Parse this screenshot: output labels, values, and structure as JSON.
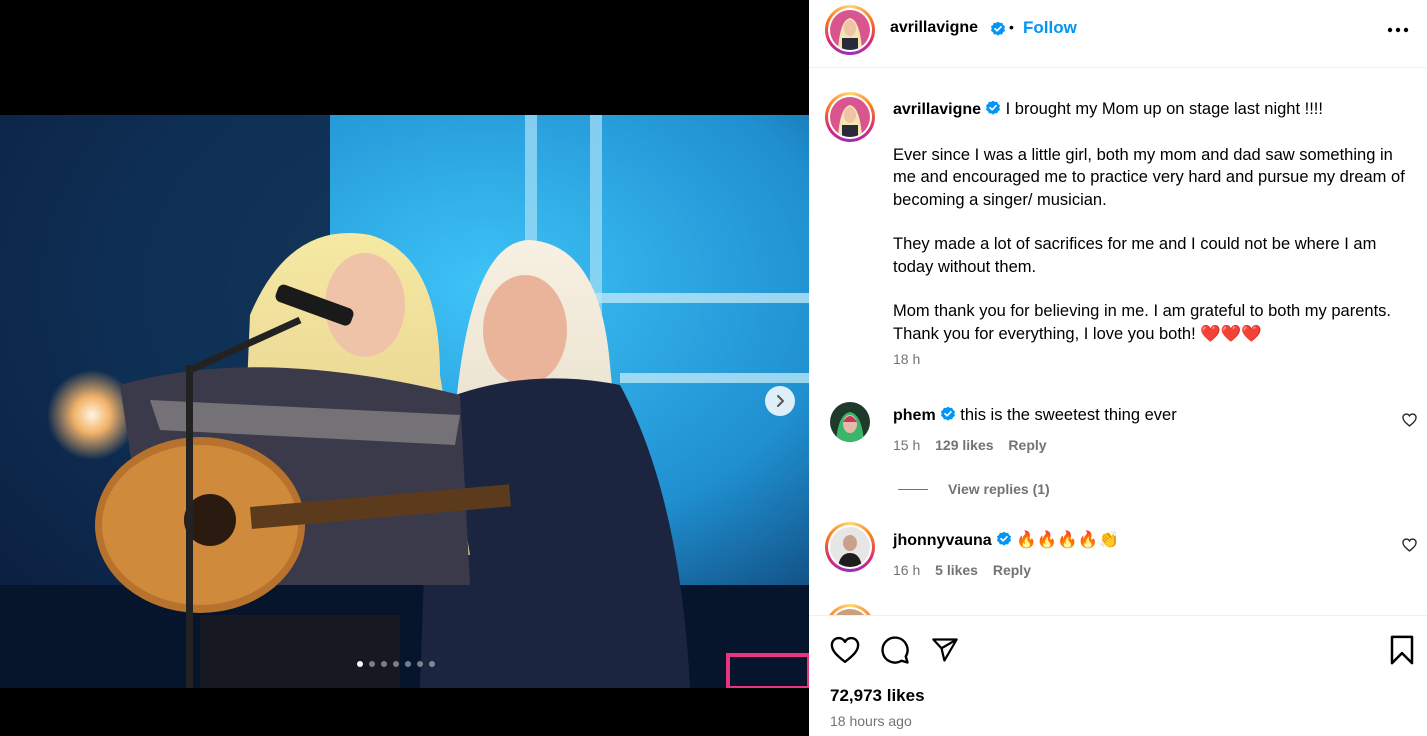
{
  "post": {
    "username": "avrillavigne",
    "separator": "•",
    "follow_label": "Follow",
    "more_icon": "more-horizontal-icon"
  },
  "caption": {
    "username": "avrillavigne",
    "line1": "I brought my Mom up on stage last night !!!!",
    "para1": "Ever since I was a little girl, both my mom and dad saw something in me and encouraged me to practice very hard and pursue my dream of becoming a singer/ musician.",
    "para2": "They made a lot of sacrifices for me and I could not be where I am today without them.",
    "para3": "Mom thank you for believing in me. I am grateful to both my parents. Thank you for everything, I love you both! ❤️❤️❤️",
    "time": "18 h"
  },
  "comments": [
    {
      "username": "phem",
      "text": "this is the sweetest thing ever",
      "time": "15 h",
      "likes": "129 likes",
      "reply": "Reply",
      "view_replies": "View replies (1)"
    },
    {
      "username": "jhonnyvauna",
      "text": "🔥🔥🔥🔥👏",
      "time": "16 h",
      "likes": "5 likes",
      "reply": "Reply"
    }
  ],
  "actions": {
    "like_icon": "heart-icon",
    "comment_icon": "comment-icon",
    "share_icon": "send-icon",
    "save_icon": "bookmark-icon"
  },
  "likes_count": "72,973 likes",
  "posted_ago": "18 hours ago",
  "carousel": {
    "slide_count": 7,
    "active_index": 0
  },
  "colors": {
    "accent": "#0095f6",
    "verified": "#0095f6",
    "muted": "#737373"
  }
}
